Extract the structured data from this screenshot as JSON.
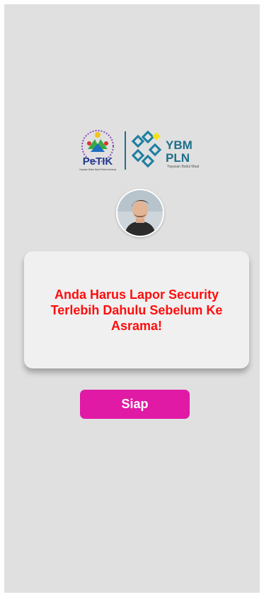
{
  "logos": {
    "petik_text": "PeTIK",
    "petik_ring_text": "Pesantren Teknologi Informasi dan Komunikasi",
    "petik_sub_text": "Yayasan Baitul Maal Pelita Indonesia",
    "ybm_text": "YBM",
    "pln_text": "PLN",
    "ybm_sub_text": "Yayasan Baitul Maal"
  },
  "dialog": {
    "message": "Anda Harus Lapor Security Terlebih Dahulu Sebelum Ke Asrama!"
  },
  "actions": {
    "confirm_label": "Siap"
  },
  "colors": {
    "background": "#e0e0e0",
    "dialog_bg": "#f0f0f0",
    "message_text": "#ff0d0d",
    "button_bg": "#e01aa5",
    "button_text": "#ffffff"
  }
}
